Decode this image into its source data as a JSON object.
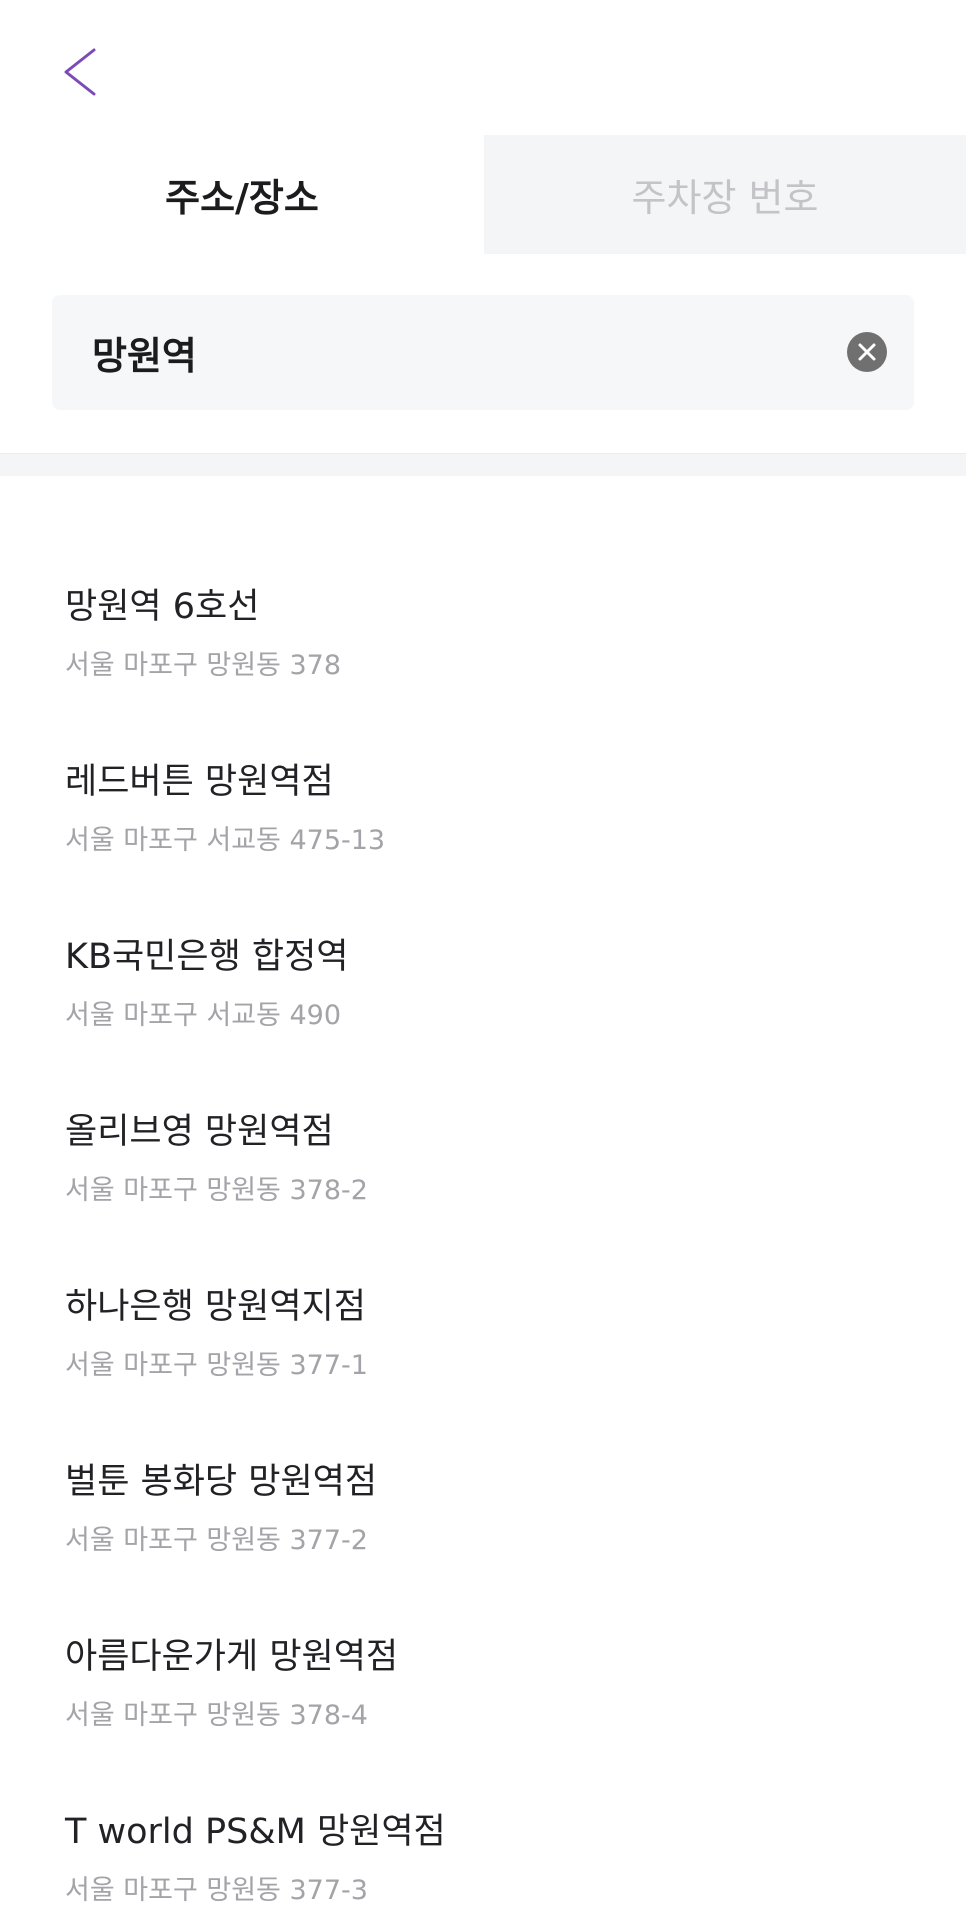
{
  "header": {
    "back_icon": "chevron-left-icon",
    "accent_color": "#7b4bb7"
  },
  "tabs": [
    {
      "label": "주소/장소",
      "active": true
    },
    {
      "label": "주차장 번호",
      "active": false
    }
  ],
  "search": {
    "value": "망원역",
    "clear_icon": "clear-circle-icon"
  },
  "results": [
    {
      "name": "망원역 6호선",
      "address": "서울 마포구 망원동 378"
    },
    {
      "name": "레드버튼 망원역점",
      "address": "서울 마포구 서교동 475-13"
    },
    {
      "name": "KB국민은행 합정역",
      "address": "서울 마포구 서교동 490"
    },
    {
      "name": "올리브영 망원역점",
      "address": "서울 마포구 망원동 378-2"
    },
    {
      "name": "하나은행 망원역지점",
      "address": "서울 마포구 망원동 377-1"
    },
    {
      "name": "벌툰 봉화당 망원역점",
      "address": "서울 마포구 망원동 377-2"
    },
    {
      "name": "아름다운가게 망원역점",
      "address": "서울 마포구 망원동 378-4"
    },
    {
      "name": "T world PS&M 망원역점",
      "address": "서울 마포구 망원동 377-3"
    }
  ]
}
